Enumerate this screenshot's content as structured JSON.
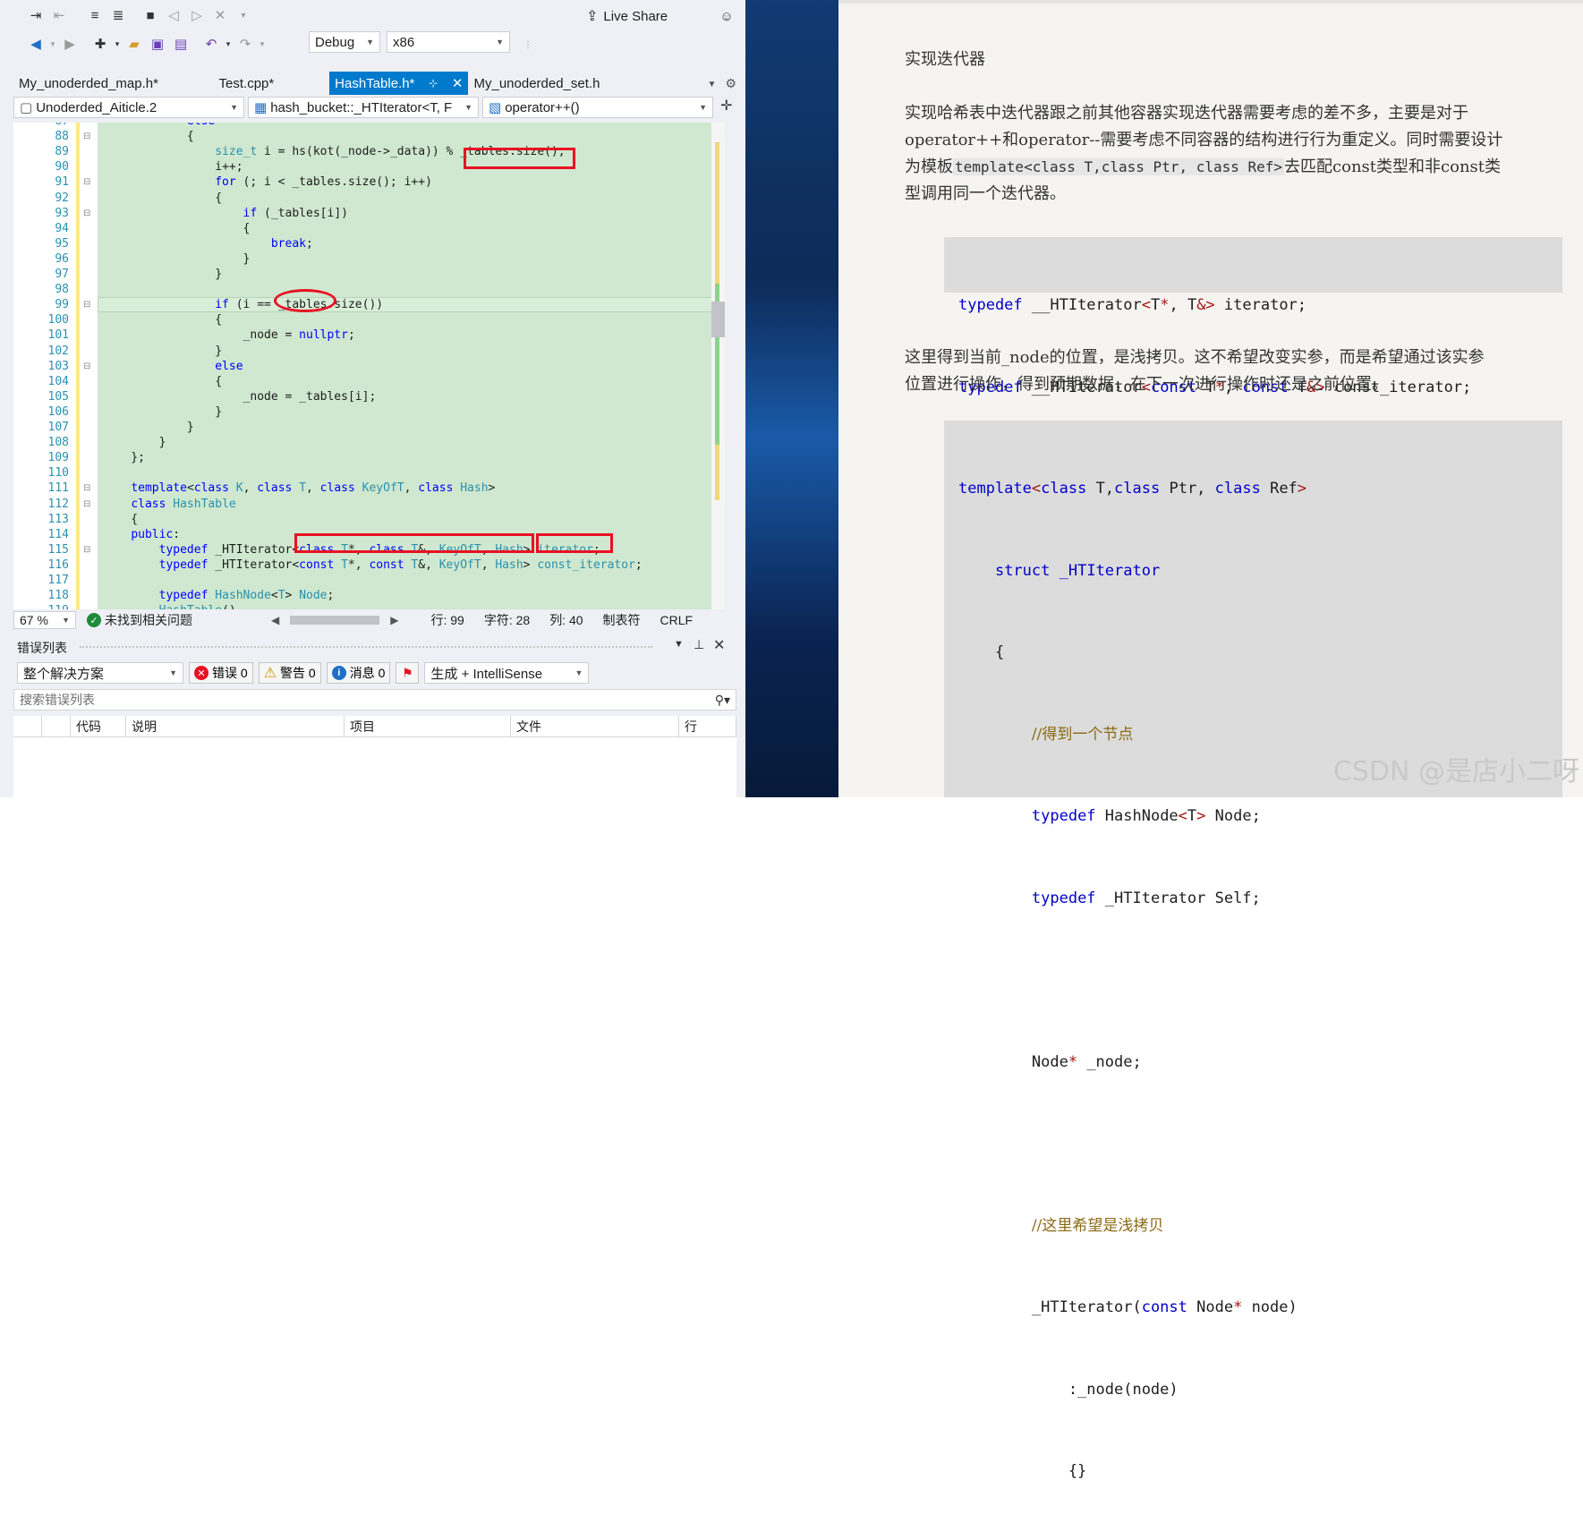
{
  "toolbar": {
    "config": "Debug",
    "platform": "x86",
    "live_share": "Live Share"
  },
  "tabs": [
    {
      "label": "My_unoderded_map.h*"
    },
    {
      "label": "Test.cpp*"
    },
    {
      "label": "HashTable.h*"
    },
    {
      "label": "My_unoderded_set.h"
    }
  ],
  "navbar": {
    "project": "Unoderded_Aiticle.2",
    "scope": "hash_bucket::_HTIterator<T, F",
    "member": "operator++()"
  },
  "code_lines": [
    {
      "n": "87",
      "text": "            else"
    },
    {
      "n": "88",
      "text": "            {"
    },
    {
      "n": "89",
      "text": "                size_t i = hs(kot(_node->_data)) % _tables.size();"
    },
    {
      "n": "90",
      "text": "                i++;"
    },
    {
      "n": "91",
      "text": "                for (; i < _tables.size(); i++)"
    },
    {
      "n": "92",
      "text": "                {"
    },
    {
      "n": "93",
      "text": "                    if (_tables[i])"
    },
    {
      "n": "94",
      "text": "                    {"
    },
    {
      "n": "95",
      "text": "                        break;"
    },
    {
      "n": "96",
      "text": "                    }"
    },
    {
      "n": "97",
      "text": "                }"
    },
    {
      "n": "98",
      "text": ""
    },
    {
      "n": "99",
      "text": "                if (i == _tables.size())"
    },
    {
      "n": "100",
      "text": "                {"
    },
    {
      "n": "101",
      "text": "                    _node = nullptr;"
    },
    {
      "n": "102",
      "text": "                }"
    },
    {
      "n": "103",
      "text": "                else"
    },
    {
      "n": "104",
      "text": "                {"
    },
    {
      "n": "105",
      "text": "                    _node = _tables[i];"
    },
    {
      "n": "106",
      "text": "                }"
    },
    {
      "n": "107",
      "text": "            }"
    },
    {
      "n": "108",
      "text": "        }"
    },
    {
      "n": "109",
      "text": "    };"
    },
    {
      "n": "110",
      "text": ""
    },
    {
      "n": "111",
      "text": "    template<class K, class T, class KeyOfT, class Hash>"
    },
    {
      "n": "112",
      "text": "    class HashTable"
    },
    {
      "n": "113",
      "text": "    {"
    },
    {
      "n": "114",
      "text": "    public:"
    },
    {
      "n": "115",
      "text": "        typedef _HTIterator<class T*, class T&, KeyOfT, Hash> iterator;"
    },
    {
      "n": "116",
      "text": "        typedef _HTIterator<const T*, const T&, KeyOfT, Hash> const_iterator;"
    },
    {
      "n": "117",
      "text": ""
    },
    {
      "n": "118",
      "text": "        typedef HashNode<T> Node;"
    },
    {
      "n": "119",
      "text": "        HashTable()"
    }
  ],
  "status": {
    "zoom": "67 %",
    "issues": "未找到相关问题",
    "line": "行: 99",
    "char": "字符: 28",
    "col": "列: 40",
    "tabs": "制表符",
    "eol": "CRLF"
  },
  "error_list": {
    "title": "错误列表",
    "scope": "整个解决方案",
    "errors": "错误 0",
    "warnings": "警告 0",
    "messages": "消息 0",
    "build": "生成 + IntelliSense",
    "search_placeholder": "搜索错误列表",
    "columns": [
      "代码",
      "说明",
      "项目",
      "文件",
      "行"
    ]
  },
  "article": {
    "heading": "实现迭代器",
    "para1_a": "实现哈希表中迭代器跟之前其他容器实现迭代器需要考虑的差不多，主要是对于",
    "para1_b": "operator++和operator--需要考虑不同容器的结构进行行为重定义。同时需要设计",
    "para1_c_pre": "为模板",
    "para1_c_code": "template<class T,class Ptr, class Ref>",
    "para1_c_post": "去匹配const类型和非const类",
    "para1_d": "型调用同一个迭代器。",
    "block1": [
      "typedef __HTIterator<T*, T&> iterator;",
      "typedef __HTIterator<const T*, const T&> const_iterator;"
    ],
    "para2_a": "这里得到当前_node的位置，是浅拷贝。这不希望改变实参，而是希望通过该实参",
    "para2_b": "位置进行操作，得到预期数据，在下一次进行操作时还是之前位置。",
    "block2": [
      "template<class T,class Ptr, class Ref>",
      "    struct _HTIterator",
      "    {",
      "        //得到一个节点",
      "        typedef HashNode<T> Node;",
      "        typedef _HTIterator Self;",
      "",
      "        Node* _node;",
      "",
      "        //这里希望是浅拷贝",
      "        _HTIterator(const Node* node)",
      "            :_node(node)",
      "            {}"
    ],
    "watermark": "CSDN @是店小二呀"
  },
  "colors": {
    "vs_accent": "#007acc",
    "code_bg": "#cfe8cf",
    "keyword": "#0000ff",
    "type": "#2b91af",
    "annotation": "#e81123"
  }
}
